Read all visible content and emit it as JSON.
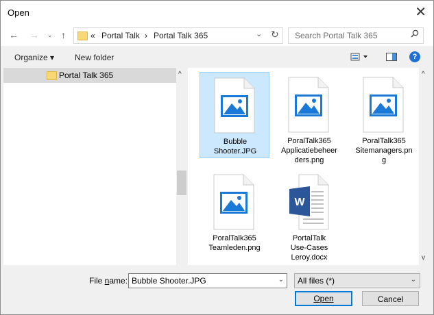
{
  "window": {
    "title": "Open"
  },
  "navigation": {
    "path": [
      "Portal Talk",
      "Portal Talk 365"
    ],
    "overflow_glyph": "«",
    "separator": "›",
    "search_placeholder": "Search Portal Talk 365"
  },
  "toolbar": {
    "organize_label": "Organize",
    "new_folder_label": "New folder",
    "help_label": "?"
  },
  "nav_pane": {
    "items": [
      {
        "label": "Portal Talk 365",
        "selected": true
      }
    ]
  },
  "files": [
    {
      "name_lines": [
        "Bubble",
        "Shooter.JPG"
      ],
      "type": "image",
      "selected": true
    },
    {
      "name_lines": [
        "PoralTalk365",
        "Applicatiebeheer",
        "ders.png"
      ],
      "type": "image",
      "selected": false
    },
    {
      "name_lines": [
        "PoralTalk365",
        "Sitemanagers.pn",
        "g"
      ],
      "type": "image",
      "selected": false
    },
    {
      "name_lines": [
        "PoralTalk365",
        "Teamleden.png"
      ],
      "type": "image",
      "selected": false
    },
    {
      "name_lines": [
        "PortalTalk",
        "Use-Cases",
        "Leroy.docx"
      ],
      "type": "word",
      "selected": false
    }
  ],
  "bottom": {
    "file_name_label": "File name:",
    "file_name_accesskey": "n",
    "file_name_value": "Bubble Shooter.JPG",
    "file_type_value": "All files (*)",
    "open_label": "Open",
    "cancel_label": "Cancel"
  },
  "colors": {
    "accent": "#0078d7",
    "selection": "#cce8ff",
    "image_icon": "#1a78d6",
    "word_icon": "#2b579a"
  }
}
